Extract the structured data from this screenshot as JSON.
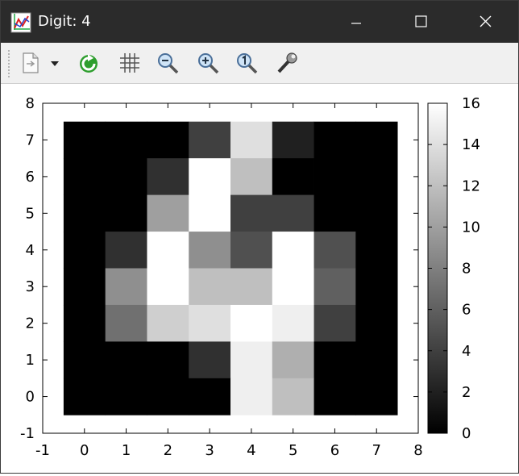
{
  "window": {
    "title": "Digit: 4"
  },
  "toolbar": {
    "items": [
      "export-icon",
      "export-dropdown-icon",
      "replot-icon",
      "grid-icon",
      "zoom-out-icon",
      "zoom-in-icon",
      "zoom-reset-icon",
      "settings-icon"
    ]
  },
  "colors": {
    "titlebar": "#2b2b2b",
    "toolbar": "#f0f0f0"
  },
  "chart_data": {
    "type": "heatmap",
    "title": "",
    "xlabel": "",
    "ylabel": "",
    "xlim": [
      -1,
      8
    ],
    "ylim": [
      -1,
      8
    ],
    "x_ticks": [
      "-1",
      "0",
      "1",
      "2",
      "3",
      "4",
      "5",
      "6",
      "7",
      "8"
    ],
    "y_ticks": [
      "-1",
      "0",
      "1",
      "2",
      "3",
      "4",
      "5",
      "6",
      "7",
      "8"
    ],
    "colorbar": {
      "min": 0,
      "max": 16,
      "ticks": [
        "0",
        "2",
        "4",
        "6",
        "8",
        "10",
        "12",
        "14",
        "16"
      ],
      "colormap": "gray"
    },
    "rows_y_from_7_to_0": [
      [
        0,
        0,
        0,
        4,
        14,
        2,
        0,
        0
      ],
      [
        0,
        0,
        3,
        16,
        12,
        0,
        0,
        0
      ],
      [
        0,
        0,
        10,
        16,
        4,
        4,
        0,
        0
      ],
      [
        0,
        3,
        16,
        9,
        5,
        16,
        5,
        0
      ],
      [
        0,
        9,
        16,
        12,
        12,
        16,
        6,
        0
      ],
      [
        0,
        7,
        13,
        14,
        16,
        15,
        4,
        0
      ],
      [
        0,
        0,
        0,
        3,
        15,
        11,
        0,
        0
      ],
      [
        0,
        0,
        0,
        0,
        15,
        12,
        0,
        0
      ]
    ]
  }
}
